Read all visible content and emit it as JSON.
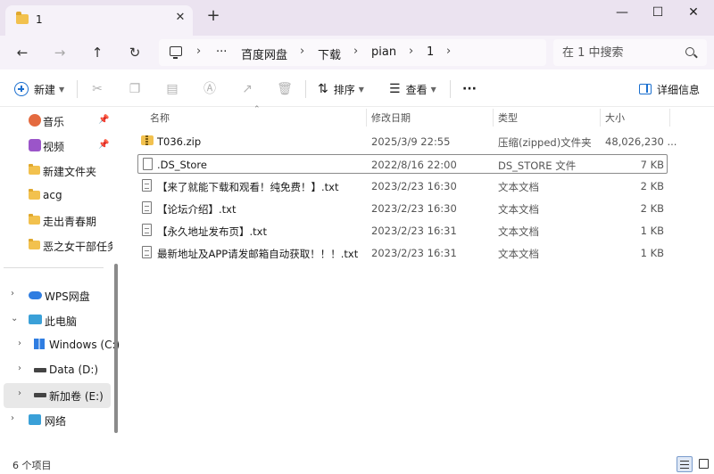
{
  "tab": {
    "title": "1",
    "close": "✕",
    "new": "+"
  },
  "window_controls": {
    "minimize": "—",
    "maximize": "☐",
    "close": "✕"
  },
  "nav": {
    "back": "←",
    "forward": "→",
    "up": "↑",
    "refresh": "↻"
  },
  "address": {
    "more": "···",
    "separator": "›",
    "crumbs": [
      "百度网盘",
      "下载",
      "pian",
      "1"
    ]
  },
  "search": {
    "placeholder": "在 1 中搜索"
  },
  "toolbar": {
    "new_label": "新建",
    "sort_label": "排序",
    "view_label": "查看",
    "more": "···",
    "details_label": "详细信息"
  },
  "sidebar": {
    "quick": [
      {
        "label": "音乐",
        "icon": "music-icon",
        "pinned": true
      },
      {
        "label": "视频",
        "icon": "video-icon",
        "pinned": true
      },
      {
        "label": "新建文件夹",
        "icon": "folder-icon"
      },
      {
        "label": "acg",
        "icon": "folder-icon"
      },
      {
        "label": "走出青春期",
        "icon": "folder-icon"
      },
      {
        "label": "恶之女干部任务",
        "icon": "folder-icon"
      }
    ],
    "tree": [
      {
        "label": "WPS网盘",
        "icon": "cloud-icon"
      },
      {
        "label": "此电脑",
        "icon": "this-pc-icon",
        "expanded": true
      },
      {
        "label": "Windows (C:)",
        "icon": "windows-drive-icon"
      },
      {
        "label": "Data (D:)",
        "icon": "drive-icon"
      },
      {
        "label": "新加卷 (E:)",
        "icon": "drive-icon",
        "selected": true
      },
      {
        "label": "网络",
        "icon": "network-icon"
      }
    ]
  },
  "columns": {
    "name": "名称",
    "modified": "修改日期",
    "type": "类型",
    "size": "大小"
  },
  "files": [
    {
      "name": "T036.zip",
      "modified": "2025/3/9 22:55",
      "type": "压缩(zipped)文件夹",
      "size": "48,026,230 ...",
      "icon": "zip-icon"
    },
    {
      "name": ".DS_Store",
      "modified": "2022/8/16 22:00",
      "type": "DS_STORE 文件",
      "size": "7 KB",
      "icon": "file-icon",
      "focused": true
    },
    {
      "name": "【来了就能下载和观看！纯免费！】.txt",
      "modified": "2023/2/23 16:30",
      "type": "文本文档",
      "size": "2 KB",
      "icon": "text-file-icon"
    },
    {
      "name": "【论坛介绍】.txt",
      "modified": "2023/2/23 16:30",
      "type": "文本文档",
      "size": "2 KB",
      "icon": "text-file-icon"
    },
    {
      "name": "【永久地址发布页】.txt",
      "modified": "2023/2/23 16:31",
      "type": "文本文档",
      "size": "1 KB",
      "icon": "text-file-icon"
    },
    {
      "name": "最新地址及APP请发邮箱自动获取！！！.txt",
      "modified": "2023/2/23 16:31",
      "type": "文本文档",
      "size": "1 KB",
      "icon": "text-file-icon"
    }
  ],
  "status": {
    "count": "6 个项目"
  },
  "colors": {
    "accent": "#1a6fcf",
    "folder": "#f2c14e",
    "titlebar": "#ebe3f0"
  }
}
